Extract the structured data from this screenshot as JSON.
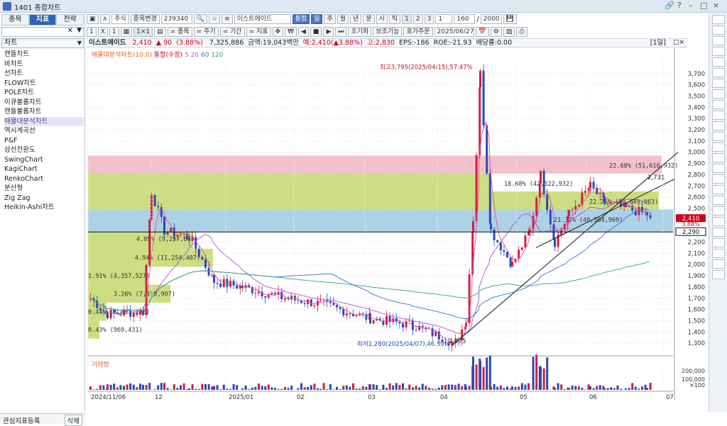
{
  "window": {
    "title": "1401 종합차트",
    "controls": [
      "🔗",
      "?",
      "–",
      "□",
      "×"
    ]
  },
  "left": {
    "tabs": [
      {
        "label": "종목"
      },
      {
        "label": "지표",
        "active": true
      },
      {
        "label": "전략"
      }
    ],
    "category": "차트",
    "items": [
      "캔들차트",
      "바차트",
      "선차트",
      "FLOW차트",
      "POLE차트",
      "이큐볼륨차트",
      "캔들볼륨차트",
      "매물대분석차트",
      "역시계곡선",
      "P&F",
      "삼선전환도",
      "SwingChart",
      "KagiChart",
      "RenkoChart",
      "분산형",
      "Zig Zag",
      "Heikin-Ashi차트"
    ],
    "selected_index": 7,
    "bottom_label": "관심지표등록",
    "delete_label": "삭제"
  },
  "toolbar1": {
    "type": "주식",
    "change_label": "종목변경",
    "code": "239340",
    "name": "이스트에이드",
    "integrated": "통합",
    "periods": [
      "일",
      "주",
      "월",
      "년",
      "분",
      "시",
      "틱"
    ],
    "nums": [
      "1",
      "2",
      "3"
    ],
    "unit": "1",
    "count": "160",
    "total": "2000"
  },
  "toolbar2": {
    "scale": [
      "1",
      "X",
      "1"
    ],
    "items": [
      "= 종목",
      "= 주기",
      "= 기간",
      "= 지표"
    ],
    "reset": "초기화",
    "assist": "보조기능",
    "order": "호가주문",
    "date": "2025/06/27"
  },
  "info": {
    "name": "이스트에이드",
    "price": "2,410",
    "change": "▲ 90",
    "pct": "(3.88%)",
    "volume": "7,325,886",
    "amount": "금액:19,043백만",
    "expected": "예:2,410(▲3.88%)",
    "high": "고:2,830",
    "eps": "EPS:-186",
    "roe": "ROE:-21.93",
    "div": "배당률:0.00",
    "period": "[1일]"
  },
  "legend": {
    "main": "매물대분석차트(10,0)",
    "candle": "통합(수정)",
    "ma": [
      {
        "label": "5",
        "color": "#e34ea8"
      },
      {
        "label": "20",
        "color": "#b04bd6"
      },
      {
        "label": "60",
        "color": "#3a6fd8"
      },
      {
        "label": "120",
        "color": "#2aa58a"
      }
    ]
  },
  "volume_label": "거래량",
  "chart_data": {
    "type": "candlestick",
    "ylim": [
      1200,
      3850
    ],
    "y_ticks": [
      "3,700",
      "3,600",
      "3,500",
      "3,400",
      "3,300",
      "3,200",
      "3,100",
      "3,000",
      "2,900",
      "2,800",
      "2,700",
      "2,600",
      "2,500",
      "2,400",
      "2,300",
      "2,200",
      "2,100",
      "2,000",
      "1,900",
      "1,800",
      "1,700",
      "1,600",
      "1,500",
      "1,400",
      "1,300"
    ],
    "x_ticks": [
      "2024/11/06",
      "12",
      "2025/01",
      "02",
      "03",
      "04",
      "05",
      "06",
      "07"
    ],
    "volume_ticks": [
      "200,000",
      "100,000",
      "×100"
    ],
    "annotations": [
      "최고3,795(2025/04/15),57.47%",
      "최저1,280(2025/04/07),46.89%",
      "2,731",
      "2,275"
    ],
    "current_price_label": "2,410",
    "current_pct_label": "3.88%",
    "level_label": "2,290",
    "volume_profile": [
      "22.68% (51,616,932)",
      "18.68% (42,522,932)",
      "22.25% (50,649,063)",
      "21.31% (48,504,969)",
      "4.09% (9,297,863)",
      "4.94% (11,254,407)",
      "1.91% (4,357,527)",
      "3.26% (7,419,907)",
      "0.44% (1,007,780)",
      "0.43% (969,431)"
    ]
  }
}
